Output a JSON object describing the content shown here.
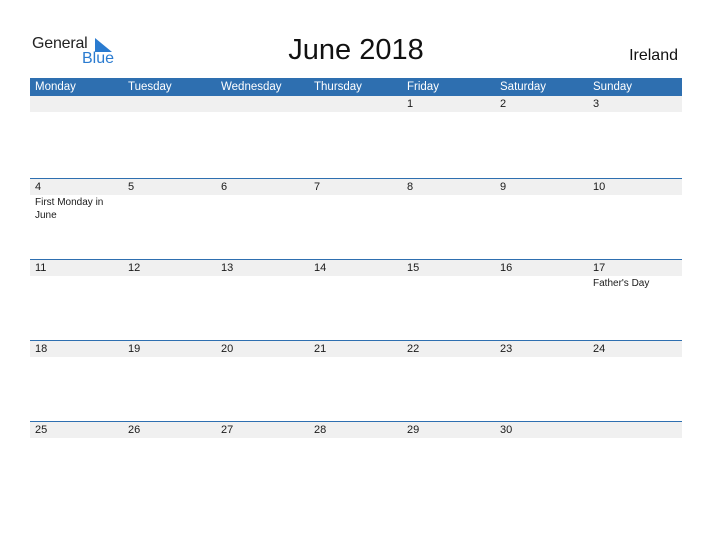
{
  "logo": {
    "line1": "General",
    "line2": "Blue"
  },
  "title": "June 2018",
  "country": "Ireland",
  "colors": {
    "header": "#2e6fb0",
    "strip": "#f0f0f0",
    "brand": "#2a7bd0"
  },
  "days": [
    "Monday",
    "Tuesday",
    "Wednesday",
    "Thursday",
    "Friday",
    "Saturday",
    "Sunday"
  ],
  "weeks": [
    [
      {
        "d": ""
      },
      {
        "d": ""
      },
      {
        "d": ""
      },
      {
        "d": ""
      },
      {
        "d": "1"
      },
      {
        "d": "2"
      },
      {
        "d": "3"
      }
    ],
    [
      {
        "d": "4",
        "e": "First Monday in June"
      },
      {
        "d": "5"
      },
      {
        "d": "6"
      },
      {
        "d": "7"
      },
      {
        "d": "8"
      },
      {
        "d": "9"
      },
      {
        "d": "10"
      }
    ],
    [
      {
        "d": "11"
      },
      {
        "d": "12"
      },
      {
        "d": "13"
      },
      {
        "d": "14"
      },
      {
        "d": "15"
      },
      {
        "d": "16"
      },
      {
        "d": "17",
        "e": "Father's Day"
      }
    ],
    [
      {
        "d": "18"
      },
      {
        "d": "19"
      },
      {
        "d": "20"
      },
      {
        "d": "21"
      },
      {
        "d": "22"
      },
      {
        "d": "23"
      },
      {
        "d": "24"
      }
    ],
    [
      {
        "d": "25"
      },
      {
        "d": "26"
      },
      {
        "d": "27"
      },
      {
        "d": "28"
      },
      {
        "d": "29"
      },
      {
        "d": "30"
      },
      {
        "d": ""
      }
    ]
  ]
}
